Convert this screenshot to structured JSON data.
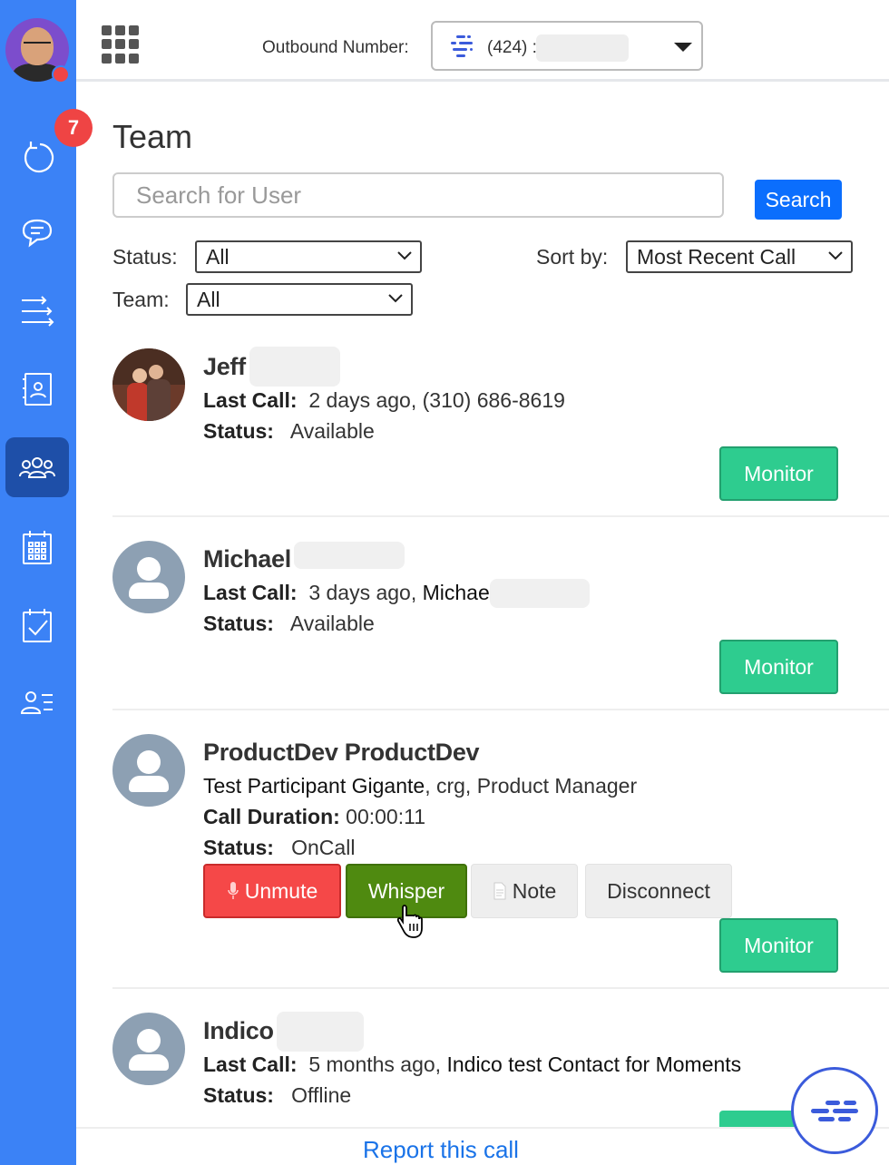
{
  "sidebar": {
    "badge_count": "7",
    "items": [
      {
        "icon": "refresh-icon"
      },
      {
        "icon": "chat-icon"
      },
      {
        "icon": "transfer-icon"
      },
      {
        "icon": "contacts-icon"
      },
      {
        "icon": "team-icon",
        "active": true
      },
      {
        "icon": "calendar-icon"
      },
      {
        "icon": "tasks-icon"
      },
      {
        "icon": "user-list-icon"
      }
    ]
  },
  "header": {
    "outbound_label": "Outbound Number:",
    "outbound_number": "(424) :"
  },
  "page": {
    "title": "Team",
    "search_placeholder": "Search for User",
    "search_button": "Search",
    "status_label": "Status:",
    "status_value": "All",
    "sort_label": "Sort by:",
    "sort_value": "Most Recent Call",
    "team_label": "Team:",
    "team_value": "All"
  },
  "users": [
    {
      "name": "Jeff",
      "last_call_label": "Last Call:",
      "last_call": "2 days ago, (310) 686-8619",
      "status_label": "Status:",
      "status": "Available",
      "monitor_label": "Monitor"
    },
    {
      "name": "Michael",
      "last_call_label": "Last Call:",
      "last_call_prefix": "3 days ago,",
      "last_call_contact": "Michael",
      "status_label": "Status:",
      "status": "Available",
      "monitor_label": "Monitor"
    },
    {
      "name": "ProductDev ProductDev",
      "participant": "Test Participant Gigante",
      "participant_detail": ", crg, Product Manager",
      "duration_label": "Call Duration:",
      "duration": "00:00:11",
      "status_label": "Status:",
      "status": "OnCall",
      "unmute_label": "Unmute",
      "whisper_label": "Whisper",
      "note_label": "Note",
      "disconnect_label": "Disconnect",
      "monitor_label": "Monitor"
    },
    {
      "name": "Indico",
      "last_call_label": "Last Call:",
      "last_call_prefix": "5 months ago,",
      "last_call_contact": "Indico test Contact for Moments",
      "status_label": "Status:",
      "status": "Offline"
    }
  ],
  "footer": {
    "report_link": "Report this call"
  },
  "colors": {
    "sidebar": "#3b82f6",
    "primary": "#0b6efd",
    "monitor": "#2ecc8f",
    "unmute": "#f54848",
    "whisper": "#4f8a10",
    "badge": "#ef4444"
  }
}
